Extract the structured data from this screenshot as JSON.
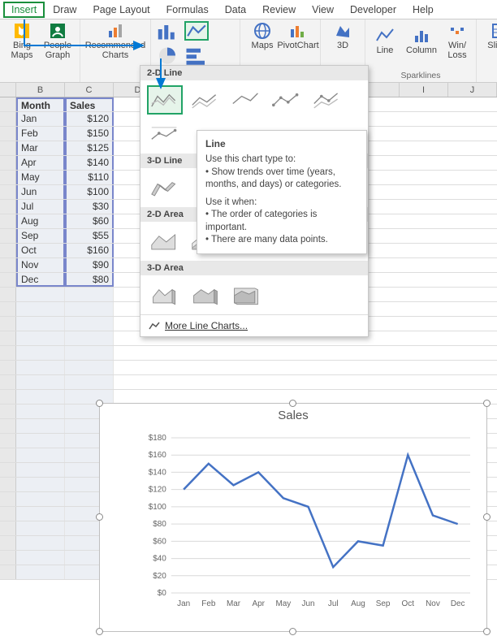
{
  "tabs": [
    "Insert",
    "Draw",
    "Page Layout",
    "Formulas",
    "Data",
    "Review",
    "View",
    "Developer",
    "Help"
  ],
  "active_tab": "Insert",
  "ribbon": {
    "bing_maps": "Bing Maps",
    "people_graph": "People Graph",
    "recommended": "Recommended Charts",
    "maps": "Maps",
    "pivotchart": "PivotChart",
    "threed": "3D",
    "line_spark": "Line",
    "column_spark": "Column",
    "winloss": "Win/ Loss",
    "sparklines_label": "Sparklines",
    "slicer": "Slicer"
  },
  "dropdown": {
    "sec1": "2-D Line",
    "sec2": "3-D Line",
    "sec3": "2-D Area",
    "sec4": "3-D Area",
    "more": "More Line Charts..."
  },
  "tooltip": {
    "title": "Line",
    "lead": "Use this chart type to:",
    "b1": "• Show trends over time (years, months, and days) or categories.",
    "lead2": "Use it when:",
    "b2": "• The order of categories is important.",
    "b3": "• There are many data points."
  },
  "columns": [
    "B",
    "C",
    "D",
    "I",
    "J"
  ],
  "headers": {
    "month": "Month",
    "sales": "Sales"
  },
  "data": [
    {
      "m": "Jan",
      "s": "$120"
    },
    {
      "m": "Feb",
      "s": "$150"
    },
    {
      "m": "Mar",
      "s": "$125"
    },
    {
      "m": "Apr",
      "s": "$140"
    },
    {
      "m": "May",
      "s": "$110"
    },
    {
      "m": "Jun",
      "s": "$100"
    },
    {
      "m": "Jul",
      "s": "$30"
    },
    {
      "m": "Aug",
      "s": "$60"
    },
    {
      "m": "Sep",
      "s": "$55"
    },
    {
      "m": "Oct",
      "s": "$160"
    },
    {
      "m": "Nov",
      "s": "$90"
    },
    {
      "m": "Dec",
      "s": "$80"
    }
  ],
  "chart_data": {
    "type": "line",
    "title": "Sales",
    "categories": [
      "Jan",
      "Feb",
      "Mar",
      "Apr",
      "May",
      "Jun",
      "Jul",
      "Aug",
      "Sep",
      "Oct",
      "Nov",
      "Dec"
    ],
    "values": [
      120,
      150,
      125,
      140,
      110,
      100,
      30,
      60,
      55,
      160,
      90,
      80
    ],
    "ylim": [
      0,
      180
    ],
    "ystep": 20,
    "yprefix": "$",
    "xlabel": "",
    "ylabel": ""
  }
}
